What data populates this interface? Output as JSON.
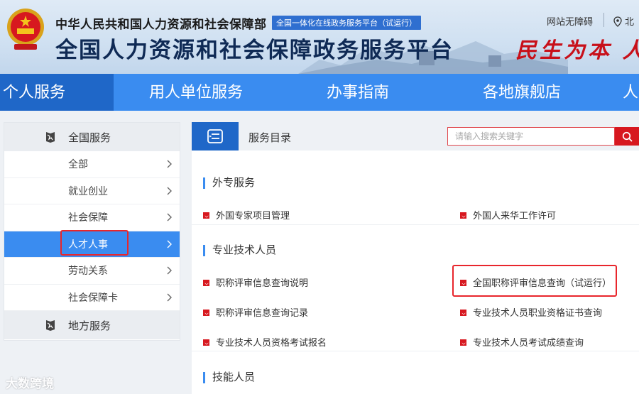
{
  "header": {
    "org_name": "中华人民共和国人力资源和社会保障部",
    "tagline": "全国一体化在线政务服务平台（试运行）",
    "platform_title": "全国人力资源和社会保障政务服务平台",
    "slogan": "民生为本 人",
    "accessibility_link": "网站无障碍",
    "location": "北",
    "emblem_icon": "national-emblem-icon",
    "location_icon": "map-pin-icon"
  },
  "nav": {
    "items": [
      {
        "label": "个人服务",
        "active": true
      },
      {
        "label": "用人单位服务",
        "active": false
      },
      {
        "label": "办事指南",
        "active": false
      },
      {
        "label": "各地旗舰店",
        "active": false
      },
      {
        "label": "人",
        "active": false
      }
    ]
  },
  "sidebar": {
    "national_label": "全国服务",
    "items": [
      {
        "label": "全部"
      },
      {
        "label": "就业创业"
      },
      {
        "label": "社会保障"
      },
      {
        "label": "人才人事"
      },
      {
        "label": "劳动关系"
      },
      {
        "label": "社会保障卡"
      }
    ],
    "active_index": 3,
    "local_label": "地方服务",
    "icon": "globe-map-icon"
  },
  "catalog": {
    "title": "服务目录",
    "search_placeholder": "请输入搜索关键字",
    "search_icon": "search-icon",
    "catalog_icon": "catalog-icon",
    "sections": [
      {
        "title": "外专服务",
        "items": [
          "外国专家项目管理",
          "外国人来华工作许可"
        ]
      },
      {
        "title": "专业技术人员",
        "items": [
          "职称评审信息查询说明",
          "全国职称评审信息查询（试运行）",
          "职称评审信息查询记录",
          "专业技术人员职业资格证书查询",
          "专业技术人员资格考试报名",
          "专业技术人员考试成绩查询"
        ]
      },
      {
        "title": "技能人员",
        "items": []
      }
    ]
  },
  "colors": {
    "nav_blue": "#3a8cf0",
    "nav_active": "#1f67c8",
    "bullet_red": "#d7181f",
    "highlight_red": "#e8262c",
    "title_navy": "#0f2a55"
  },
  "watermark": "大数跨境"
}
